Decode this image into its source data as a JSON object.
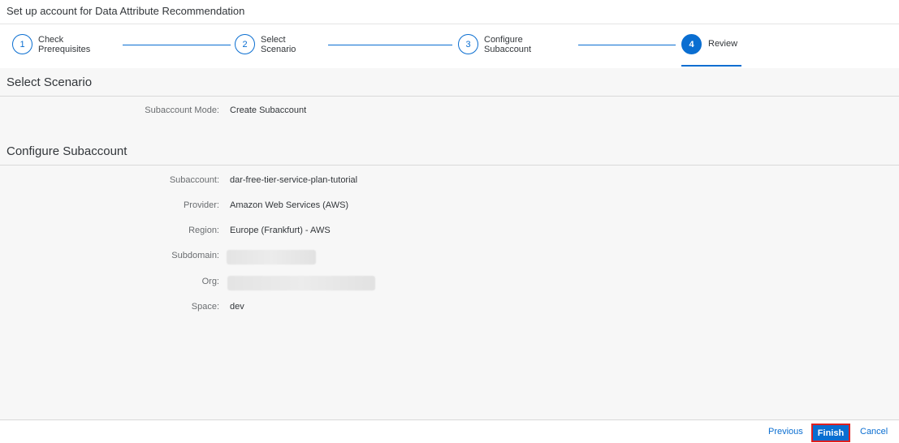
{
  "window": {
    "title": "Set up account for Data Attribute Recommendation"
  },
  "wizard": {
    "steps": [
      {
        "number": "1",
        "label": "Check Prerequisites"
      },
      {
        "number": "2",
        "label": "Select Scenario"
      },
      {
        "number": "3",
        "label": "Configure Subaccount"
      },
      {
        "number": "4",
        "label": "Review"
      }
    ],
    "active_step": 4,
    "accent_color": "#0a6ed1"
  },
  "sections": {
    "scenario": {
      "title": "Select Scenario",
      "fields": [
        {
          "label": "Subaccount Mode:",
          "value": "Create Subaccount"
        }
      ]
    },
    "subaccount": {
      "title": "Configure Subaccount",
      "fields": [
        {
          "label": "Subaccount:",
          "value": "dar-free-tier-service-plan-tutorial"
        },
        {
          "label": "Provider:",
          "value": "Amazon Web Services (AWS)"
        },
        {
          "label": "Region:",
          "value": "Europe (Frankfurt) - AWS"
        },
        {
          "label": "Subdomain:",
          "value": ""
        },
        {
          "label": "Org:",
          "value": ""
        },
        {
          "label": "Space:",
          "value": "dev"
        }
      ]
    }
  },
  "footer": {
    "previous_label": "Previous",
    "finish_label": "Finish",
    "cancel_label": "Cancel",
    "highlight_color": "#e02020"
  }
}
